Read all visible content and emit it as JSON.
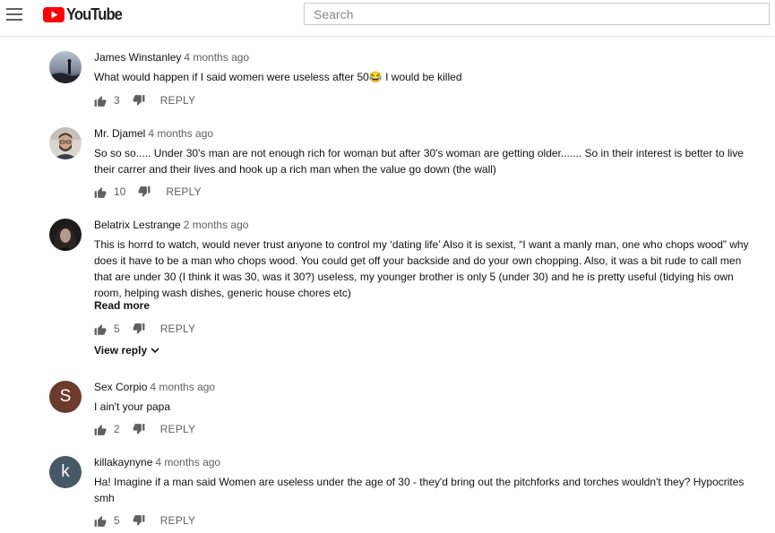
{
  "header": {
    "logo_text": "YouTube",
    "search_placeholder": "Search"
  },
  "colors": {
    "brand_red": "#ff0000",
    "icon_gray": "#606060"
  },
  "actions_labels": {
    "reply": "REPLY",
    "read_more": "Read more",
    "view_reply": "View reply"
  },
  "comments": [
    {
      "author": "James Winstanley",
      "time": "4 months ago",
      "text": "What would happen if I said women were useless after 50😂 I would be killed",
      "likes": "3"
    },
    {
      "author": "Mr. Djamel",
      "time": "4 months ago",
      "text": "So so so..... Under 30's man are not enough rich for woman but after 30's woman are getting older....... So in their interest is better to live their carrer and their lives and hook up a rich man when the value go down (the wall)",
      "likes": "10"
    },
    {
      "author": "Belatrix Lestrange",
      "time": "2 months ago",
      "text": "This is horrd to watch,  would never trust anyone to control my ‘dating life’ Also it is sexist, “I want a manly man, one who chops wood” why does it have to be a man who chops wood. You could get off your backside and do your own chopping. Also, it was a bit rude to call men that are under 30 (I think it was 30, was it 30?) useless, my younger brother is only 5 (under 30) and he is pretty useful (tidying his own room, helping wash dishes, generic house chores etc)",
      "likes": "5"
    },
    {
      "author": "Sex Corpio",
      "time": "4 months ago",
      "text": "I ain't your papa",
      "likes": "2",
      "avatar_letter": "S",
      "avatar_color": "#6d3b2c"
    },
    {
      "author": "killakaynyne",
      "time": "4 months ago",
      "text": "Ha! Imagine if a man said Women are useless under the age of 30 - they'd bring out the pitchforks and torches wouldn't they? Hypocrites smh",
      "likes": "5",
      "avatar_letter": "k",
      "avatar_color": "#455a64"
    }
  ]
}
